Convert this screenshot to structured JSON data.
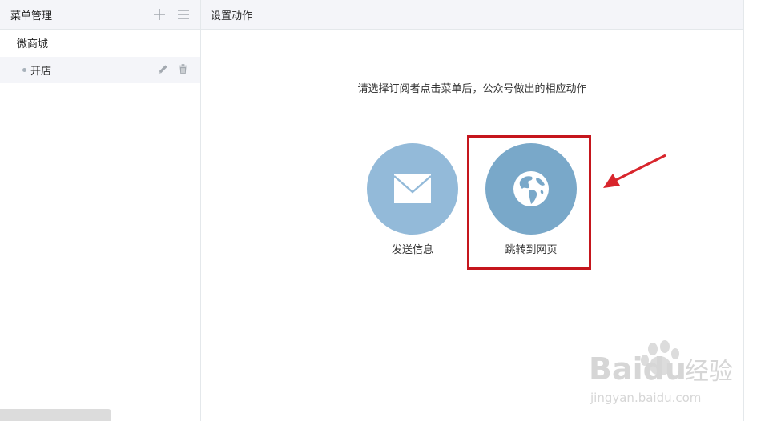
{
  "sidebar": {
    "title": "菜单管理",
    "add_icon": "plus-icon",
    "list_icon": "list-icon",
    "menus": [
      {
        "label": "微商城",
        "children": [
          {
            "label": "开店",
            "edit_icon": "pencil-icon",
            "delete_icon": "trash-icon"
          }
        ]
      }
    ]
  },
  "main": {
    "title": "设置动作",
    "prompt": "请选择订阅者点击菜单后，公众号做出的相应动作",
    "actions": [
      {
        "label": "发送信息",
        "icon": "envelope-icon",
        "color": "#93bad9"
      },
      {
        "label": "跳转到网页",
        "icon": "globe-icon",
        "color": "#79a8c9"
      }
    ],
    "highlight_color": "#c5161d"
  },
  "watermark": {
    "brand": "Baidu",
    "product": "经验",
    "url": "jingyan.baidu.com"
  }
}
